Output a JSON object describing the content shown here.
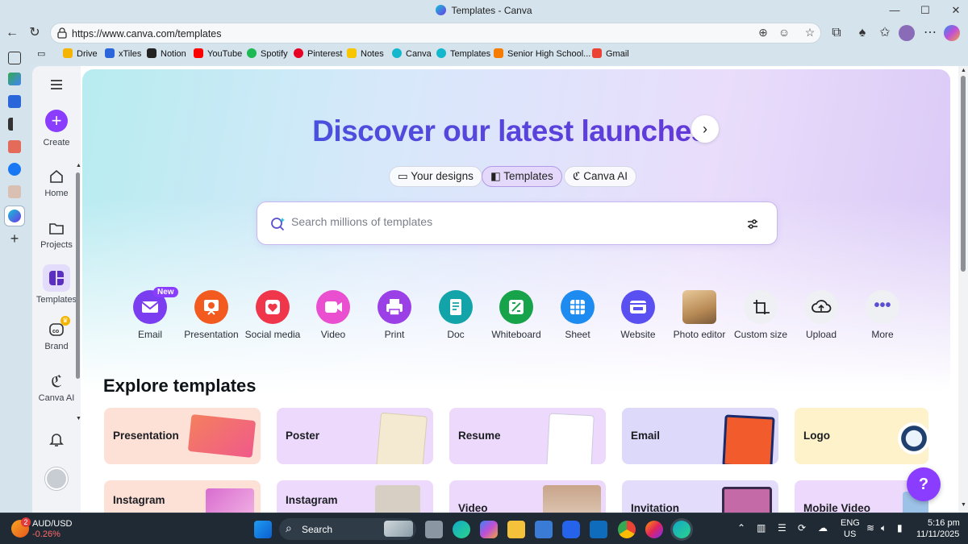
{
  "window": {
    "title": "Templates - Canva",
    "minimize": "—",
    "maximize": "☐",
    "close": "✕"
  },
  "navbar": {
    "url": "https://www.canva.com/templates"
  },
  "bookmarks": [
    {
      "label": "Drive",
      "color": "#f4b400"
    },
    {
      "label": "xTiles",
      "color": "#2a66d9"
    },
    {
      "label": "Notion",
      "color": "#222222"
    },
    {
      "label": "YouTube",
      "color": "#ff0000"
    },
    {
      "label": "Spotify",
      "color": "#1db954"
    },
    {
      "label": "Pinterest",
      "color": "#e60023"
    },
    {
      "label": "Notes",
      "color": "#f7c600"
    },
    {
      "label": "Canva",
      "color": "#14b8cc"
    },
    {
      "label": "Templates",
      "color": "#14b8cc"
    },
    {
      "label": "Senior High School...",
      "color": "#f57c00"
    },
    {
      "label": "Gmail",
      "color": "#ea4335"
    }
  ],
  "sidebar": {
    "create": "Create",
    "home": "Home",
    "projects": "Projects",
    "templates": "Templates",
    "brand": "Brand",
    "canva_ai": "Canva AI"
  },
  "hero": {
    "title": "Discover our latest launches",
    "tabs": [
      "Your designs",
      "Templates",
      "Canva AI"
    ],
    "active_tab": "Templates",
    "search_placeholder": "Search millions of templates"
  },
  "categories": [
    {
      "label": "Email",
      "color": "#7a3df0",
      "icon": "envelope-icon",
      "badge": "New"
    },
    {
      "label": "Presentation",
      "color": "#f25a1f",
      "icon": "presentation-icon"
    },
    {
      "label": "Social media",
      "color": "#f0364a",
      "icon": "heart-icon"
    },
    {
      "label": "Video",
      "color": "#ea4fd0",
      "icon": "video-icon"
    },
    {
      "label": "Print",
      "color": "#9b3fe6",
      "icon": "printer-icon"
    },
    {
      "label": "Doc",
      "color": "#12a4a8",
      "icon": "doc-icon"
    },
    {
      "label": "Whiteboard",
      "color": "#16a34a",
      "icon": "whiteboard-icon"
    },
    {
      "label": "Sheet",
      "color": "#1d8bf0",
      "icon": "sheet-icon"
    },
    {
      "label": "Website",
      "color": "#5a4ff0",
      "icon": "website-icon"
    },
    {
      "label": "Photo editor",
      "color": "#c9a77a",
      "icon": "photo-icon"
    },
    {
      "label": "Custom size",
      "color": "#eef0f3",
      "icon": "crop-icon"
    },
    {
      "label": "Upload",
      "color": "#eef0f3",
      "icon": "upload-icon"
    },
    {
      "label": "More",
      "color": "#eef0f3",
      "icon": "more-icon"
    }
  ],
  "explore": {
    "title": "Explore templates",
    "row1": [
      {
        "label": "Presentation",
        "bg": "#fde0d6",
        "art": "#f47f5e"
      },
      {
        "label": "Poster",
        "bg": "#ecd9fb",
        "art": "#f4ead2"
      },
      {
        "label": "Resume",
        "bg": "#ecd9fb",
        "art": "#ffffff"
      },
      {
        "label": "Email",
        "bg": "#dcd9fb",
        "art": "#f25c2c"
      },
      {
        "label": "Logo",
        "bg": "#fdf2c9",
        "art": "#ffffff"
      }
    ],
    "row2": [
      {
        "label": "Instagram",
        "bg": "#fde0d6",
        "art": "#d86ccf"
      },
      {
        "label": "Instagram",
        "bg": "#ecd9fb",
        "art": "#d8cfc4"
      },
      {
        "label": "Video",
        "bg": "#ecd9fb",
        "art": "#c8a58a"
      },
      {
        "label": "Invitation",
        "bg": "#e4dcfb",
        "art": "#c46aa6"
      },
      {
        "label": "Mobile Video",
        "bg": "#ecd9fb",
        "art": "#9dc2e8"
      }
    ]
  },
  "help": "?",
  "taskbar": {
    "badge": "2",
    "ticker": "AUD/USD",
    "ticker_change": "-0.26%",
    "search": "Search",
    "lang1": "ENG",
    "lang2": "US",
    "time": "5:16 pm",
    "date": "11/11/2025"
  }
}
